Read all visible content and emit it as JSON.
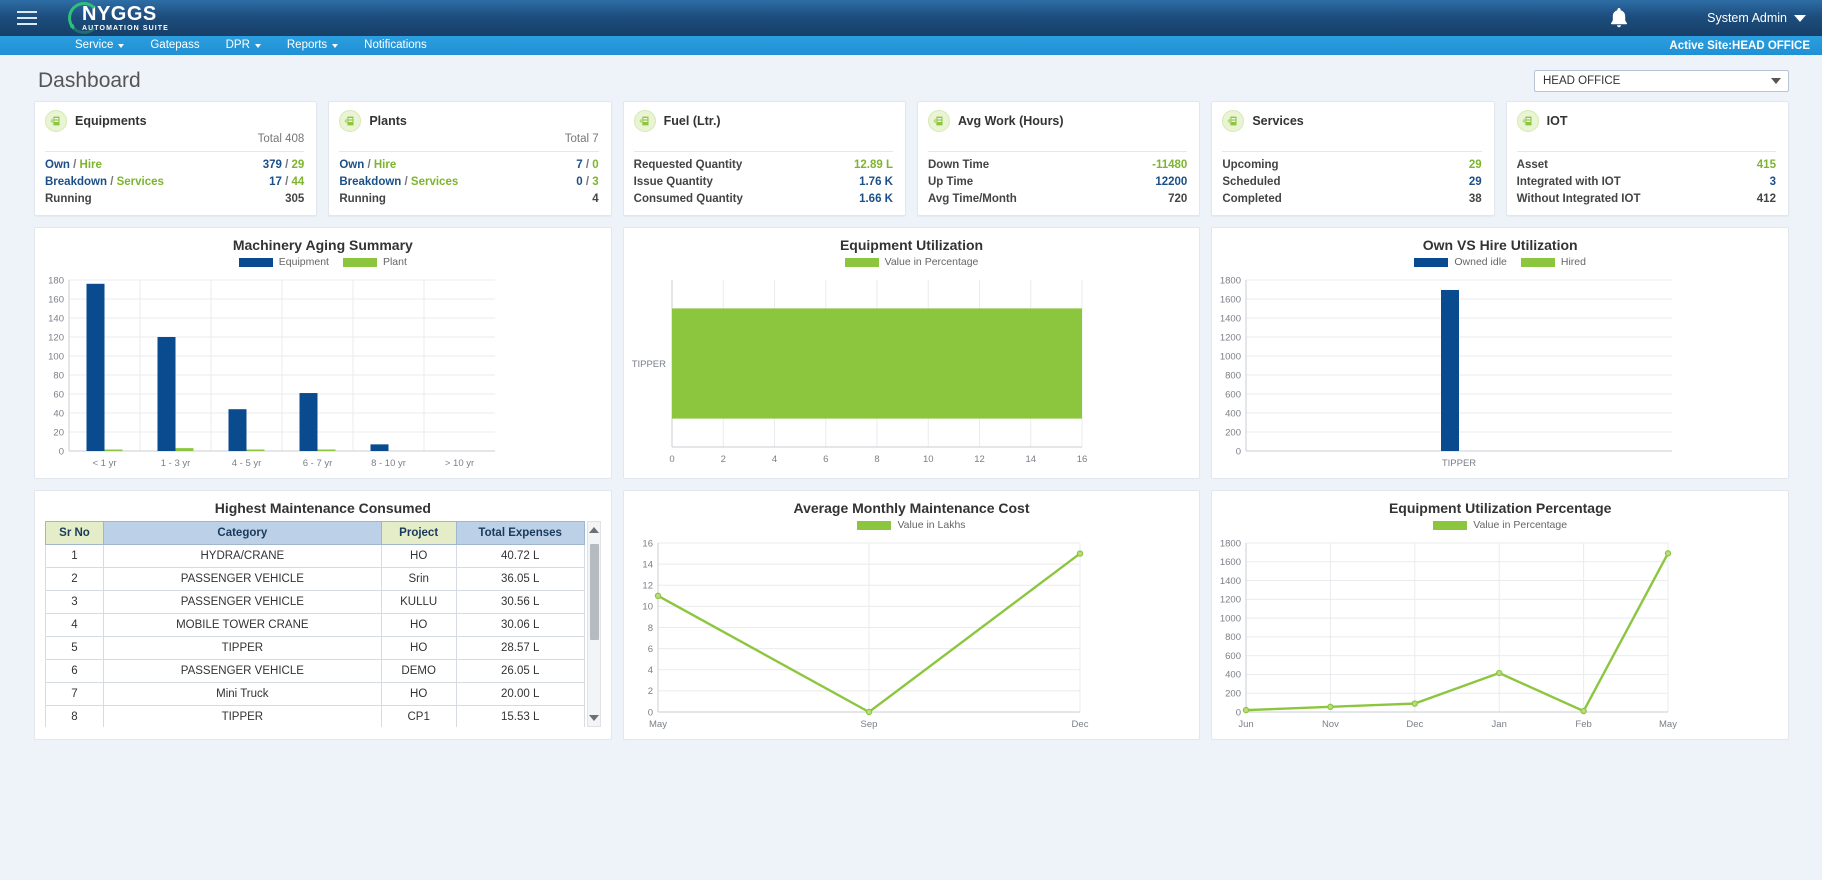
{
  "header": {
    "brand_name": "NYGGS",
    "brand_sub": "AUTOMATION SUITE",
    "user": "System Admin",
    "active_site": "Active Site:HEAD OFFICE",
    "nav": [
      {
        "label": "Service",
        "caret": true
      },
      {
        "label": "Gatepass",
        "caret": false
      },
      {
        "label": "DPR",
        "caret": true
      },
      {
        "label": "Reports",
        "caret": true
      },
      {
        "label": "Notifications",
        "caret": false
      }
    ]
  },
  "page": {
    "title": "Dashboard",
    "site_selector": "HEAD OFFICE"
  },
  "kpi_cards": [
    {
      "name": "Equipments",
      "total": "Total 408",
      "rows": [
        {
          "label_a": "Own",
          "label_b": "Hire",
          "value": "379 / 29",
          "style": "split"
        },
        {
          "label_a": "Breakdown",
          "label_b": "Services",
          "value": "17 / 44",
          "style": "split"
        },
        {
          "label_a": "Running",
          "label_b": "",
          "value": "305",
          "style": "plain"
        }
      ]
    },
    {
      "name": "Plants",
      "total": "Total 7",
      "rows": [
        {
          "label_a": "Own",
          "label_b": "Hire",
          "value": "7 / 0",
          "style": "split"
        },
        {
          "label_a": "Breakdown",
          "label_b": "Services",
          "value": "0 / 3",
          "style": "split"
        },
        {
          "label_a": "Running",
          "label_b": "",
          "value": "4",
          "style": "plain"
        }
      ]
    },
    {
      "name": "Fuel (Ltr.)",
      "total": "",
      "rows": [
        {
          "label_a": "Requested Quantity",
          "label_b": "",
          "value": "12.89 L",
          "style": "green"
        },
        {
          "label_a": "Issue Quantity",
          "label_b": "",
          "value": "1.76 K",
          "style": "blue"
        },
        {
          "label_a": "Consumed Quantity",
          "label_b": "",
          "value": "1.66 K",
          "style": "blue"
        }
      ]
    },
    {
      "name": "Avg Work (Hours)",
      "total": "",
      "rows": [
        {
          "label_a": "Down Time",
          "label_b": "",
          "value": "-11480",
          "style": "green"
        },
        {
          "label_a": "Up Time",
          "label_b": "",
          "value": "12200",
          "style": "blue"
        },
        {
          "label_a": "Avg Time/Month",
          "label_b": "",
          "value": "720",
          "style": "plain"
        }
      ]
    },
    {
      "name": "Services",
      "total": "",
      "rows": [
        {
          "label_a": "Upcoming",
          "label_b": "",
          "value": "29",
          "style": "green"
        },
        {
          "label_a": "Scheduled",
          "label_b": "",
          "value": "29",
          "style": "blue"
        },
        {
          "label_a": "Completed",
          "label_b": "",
          "value": "38",
          "style": "plain"
        }
      ]
    },
    {
      "name": "IOT",
      "total": "",
      "rows": [
        {
          "label_a": "Asset",
          "label_b": "",
          "value": "415",
          "style": "green"
        },
        {
          "label_a": "Integrated with IOT",
          "label_b": "",
          "value": "3",
          "style": "blue"
        },
        {
          "label_a": "Without Integrated IOT",
          "label_b": "",
          "value": "412",
          "style": "plain"
        }
      ]
    }
  ],
  "colors": {
    "blue": "#0a4a8f",
    "green": "#8cc63e",
    "header_blue": "#1d4e7e",
    "nav_blue": "#2090d4"
  },
  "chart_data": [
    {
      "type": "bar",
      "id": "machinery-aging-summary",
      "title": "Machinery Aging Summary",
      "categories": [
        "< 1 yr",
        "1 - 3 yr",
        "4 - 5 yr",
        "6 - 7 yr",
        "8 - 10 yr",
        "> 10 yr"
      ],
      "series": [
        {
          "name": "Equipment",
          "color": "#0a4a8f",
          "values": [
            176,
            120,
            44,
            61,
            7,
            0
          ]
        },
        {
          "name": "Plant",
          "color": "#8cc63e",
          "values": [
            1,
            3,
            1,
            1,
            0,
            0
          ]
        }
      ],
      "ylim": [
        0,
        180
      ],
      "yticks": [
        0,
        20,
        40,
        60,
        80,
        100,
        120,
        140,
        160,
        180
      ],
      "xlabel": "",
      "ylabel": "",
      "grid": true,
      "legend": "top"
    },
    {
      "type": "bar",
      "id": "equipment-utilization",
      "orientation": "horizontal",
      "title": "Equipment Utilization",
      "categories": [
        "TIPPER"
      ],
      "series": [
        {
          "name": "Value in Percentage",
          "color": "#8cc63e",
          "values": [
            16
          ]
        }
      ],
      "xlim": [
        0,
        16
      ],
      "xticks": [
        0,
        2,
        4,
        6,
        8,
        10,
        12,
        14,
        16
      ],
      "xlabel": "",
      "ylabel": "",
      "grid": true,
      "legend": "top"
    },
    {
      "type": "bar",
      "id": "own-vs-hire-utilization",
      "title": "Own VS Hire Utilization",
      "categories": [
        "TIPPER"
      ],
      "series": [
        {
          "name": "Owned idle",
          "color": "#0a4a8f",
          "values": [
            1695
          ]
        },
        {
          "name": "Hired",
          "color": "#8cc63e",
          "values": [
            0
          ]
        }
      ],
      "ylim": [
        0,
        1800
      ],
      "yticks": [
        0,
        200,
        400,
        600,
        800,
        1000,
        1200,
        1400,
        1600,
        1800
      ],
      "xlabel": "",
      "ylabel": "",
      "grid": true,
      "legend": "top"
    },
    {
      "type": "table",
      "id": "highest-maintenance-consumed",
      "title": "Highest Maintenance Consumed",
      "columns": [
        "Sr No",
        "Category",
        "Project",
        "Total Expenses"
      ],
      "rows": [
        [
          "1",
          "HYDRA/CRANE",
          "HO",
          "40.72 L"
        ],
        [
          "2",
          "PASSENGER VEHICLE",
          "Srin",
          "36.05 L"
        ],
        [
          "3",
          "PASSENGER VEHICLE",
          "KULLU",
          "30.56 L"
        ],
        [
          "4",
          "MOBILE TOWER CRANE",
          "HO",
          "30.06 L"
        ],
        [
          "5",
          "TIPPER",
          "HO",
          "28.57 L"
        ],
        [
          "6",
          "PASSENGER VEHICLE",
          "DEMO",
          "26.05 L"
        ],
        [
          "7",
          "Mini Truck",
          "HO",
          "20.00 L"
        ],
        [
          "8",
          "TIPPER",
          "CP1",
          "15.53 L"
        ]
      ]
    },
    {
      "type": "line",
      "id": "average-monthly-maintenance-cost",
      "title": "Average Monthly Maintenance Cost",
      "categories": [
        "May",
        "Sep",
        "Dec"
      ],
      "series": [
        {
          "name": "Value in Lakhs",
          "color": "#8cc63e",
          "values": [
            11,
            0,
            15
          ]
        }
      ],
      "ylim": [
        0,
        16
      ],
      "yticks": [
        0,
        2,
        4,
        6,
        8,
        10,
        12,
        14,
        16
      ],
      "xlabel": "",
      "ylabel": "",
      "grid": true,
      "legend": "top"
    },
    {
      "type": "line",
      "id": "equipment-utilization-percentage",
      "title": "Equipment Utilization Percentage",
      "categories": [
        "Jun",
        "Nov",
        "Dec",
        "Jan",
        "Feb",
        "May"
      ],
      "series": [
        {
          "name": "Value in Percentage",
          "color": "#8cc63e",
          "values": [
            20,
            55,
            90,
            415,
            10,
            1690
          ]
        }
      ],
      "ylim": [
        0,
        1800
      ],
      "yticks": [
        0,
        200,
        400,
        600,
        800,
        1000,
        1200,
        1400,
        1600,
        1800
      ],
      "xlabel": "",
      "ylabel": "",
      "grid": true,
      "legend": "top"
    }
  ]
}
